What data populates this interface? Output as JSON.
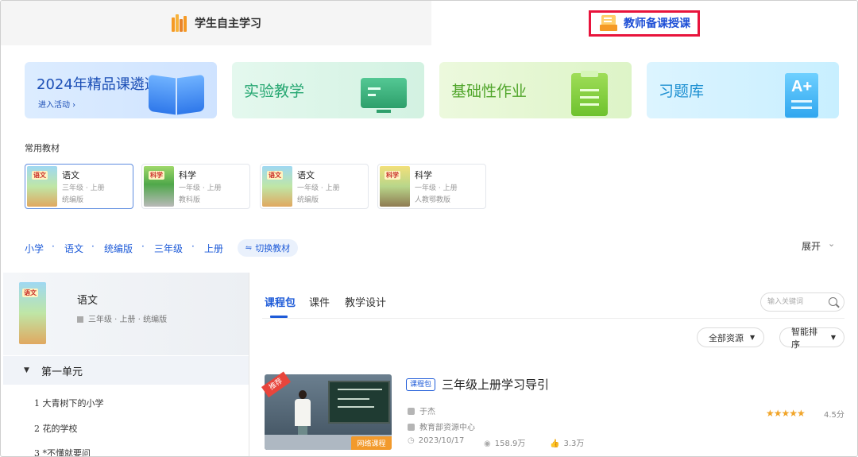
{
  "top_tabs": {
    "student": "学生自主学习",
    "teacher": "教师备课授课"
  },
  "banners": [
    {
      "title": "2024年精品课遴选",
      "subtitle": "进入活动 ›"
    },
    {
      "title": "实验教学"
    },
    {
      "title": "基础性作业"
    },
    {
      "title": "习题库"
    }
  ],
  "common_textbooks": {
    "label": "常用教材",
    "items": [
      {
        "cover_tag": "语文",
        "title": "语文",
        "grade": "三年级 · 上册",
        "edition": "统编版"
      },
      {
        "cover_tag": "科学",
        "title": "科学",
        "grade": "一年级 · 上册",
        "edition": "教科版"
      },
      {
        "cover_tag": "语文",
        "title": "语文",
        "grade": "一年级 · 上册",
        "edition": "统编版"
      },
      {
        "cover_tag": "科学",
        "title": "科学",
        "grade": "一年级 · 上册",
        "edition": "人教鄂教版"
      }
    ]
  },
  "breadcrumb": {
    "items": [
      "小学",
      "语文",
      "统编版",
      "三年级",
      "上册"
    ],
    "separator": "·",
    "switch_label": "切换教材",
    "expand_label": "展开"
  },
  "left_panel": {
    "cover_tag": "语文",
    "title": "语文",
    "meta": "三年级 · 上册 · 统编版",
    "unit": "第一单元",
    "lessons": [
      "1 大青树下的小学",
      "2 花的学校",
      "3 *不懂就要问"
    ]
  },
  "content_tabs": [
    "课程包",
    "课件",
    "教学设计"
  ],
  "search": {
    "placeholder": "输入关键词"
  },
  "filters": {
    "resources": "全部资源",
    "sort": "智能排序"
  },
  "course": {
    "badge": "推荐",
    "network_label": "网络课程",
    "type": "课程包",
    "title": "三年级上册学习导引",
    "author": "于杰",
    "org": "教育部资源中心",
    "date": "2023/10/17",
    "views": "158.9万",
    "likes": "3.3万",
    "stars": "★★★★★",
    "rating": "4.5分"
  },
  "colors": {
    "accent": "#1e5bd8",
    "highlight_box": "#e8143c",
    "star": "#f1a52a"
  }
}
